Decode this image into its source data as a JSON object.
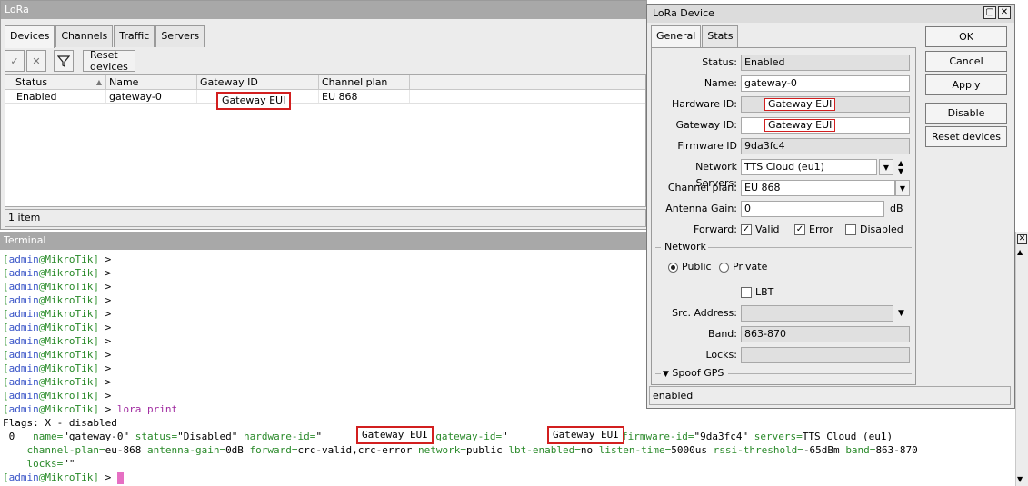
{
  "lora_window": {
    "title": "LoRa",
    "tabs": [
      "Devices",
      "Channels",
      "Traffic",
      "Servers"
    ],
    "toolbar": {
      "reset_label": "Reset devices"
    },
    "columns": [
      "Status",
      "Name",
      "Gateway ID",
      "Channel plan"
    ],
    "rows": [
      {
        "status": "Enabled",
        "name": "gateway-0",
        "gateway_id": "Gateway EUI",
        "channel_plan": "EU 868"
      }
    ],
    "item_count": "1 item"
  },
  "terminal": {
    "title": "Terminal",
    "prompt_user": "admin",
    "prompt_host": "MikroTik",
    "prompt_suffix": " >",
    "command": "lora print",
    "flags_line": "Flags: X - disabled",
    "entry": {
      "index": "0",
      "name": "\"gateway-0\"",
      "status": "\"Disabled\"",
      "hardware_id_redacted": "Gateway EUI",
      "gateway_id_redacted": "Gateway EUI",
      "firmware_id": "\"9da3fc4\"",
      "servers": "TTS Cloud (eu1)",
      "channel_plan": "eu-868",
      "antenna_gain": "0dB",
      "forward": "crc-valid,crc-error",
      "network": "public",
      "lbt_enabled": "no",
      "listen_time": "5000us",
      "rssi_threshold": "-65dBm",
      "band": "863-870",
      "locks": "\"\""
    }
  },
  "device_dialog": {
    "title": "LoRa Device",
    "tabs": [
      "General",
      "Stats"
    ],
    "fields": {
      "status_label": "Status:",
      "status": "Enabled",
      "name_label": "Name:",
      "name": "gateway-0",
      "hardware_id_label": "Hardware ID:",
      "hardware_id": "Gateway EUI",
      "gateway_id_label": "Gateway ID:",
      "gateway_id": "Gateway EUI",
      "firmware_id_label": "Firmware ID",
      "firmware_id": "9da3fc4",
      "network_servers_label": "Network Servers:",
      "network_servers": "TTS Cloud (eu1)",
      "channel_plan_label": "Channel plan:",
      "channel_plan": "EU 868",
      "antenna_gain_label": "Antenna Gain:",
      "antenna_gain": "0",
      "antenna_gain_unit": "dB",
      "forward_label": "Forward:",
      "forward_valid": "Valid",
      "forward_error": "Error",
      "forward_disabled": "Disabled",
      "network_section": "Network",
      "public": "Public",
      "private": "Private",
      "lbt": "LBT",
      "src_address_label": "Src. Address:",
      "band_label": "Band:",
      "band": "863-870",
      "locks_label": "Locks:",
      "spoof_gps": "Spoof GPS"
    },
    "buttons": {
      "ok": "OK",
      "cancel": "Cancel",
      "apply": "Apply",
      "disable": "Disable",
      "reset": "Reset devices"
    },
    "status_text": "enabled"
  }
}
